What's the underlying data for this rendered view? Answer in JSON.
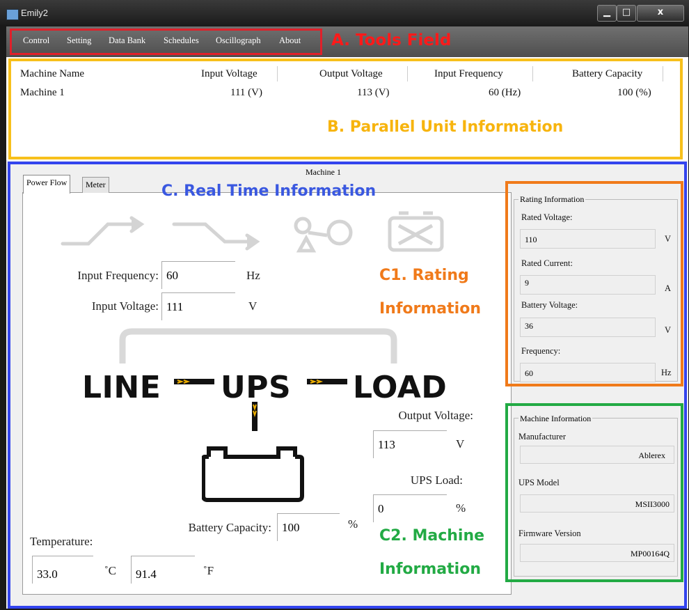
{
  "window": {
    "title": "Emily2",
    "min_glyph": "▁",
    "max_glyph": "□",
    "close_glyph": "x"
  },
  "menu": [
    "Control",
    "Setting",
    "Data Bank",
    "Schedules",
    "Oscillograph",
    "About"
  ],
  "annotations": {
    "tools": "A. Tools  Field",
    "parallel": "B. Parallel Unit Information",
    "realtime": "C. Real Time Information",
    "rating_1": "C1. Rating",
    "rating_2": "Information",
    "machine_1": "C2. Machine",
    "machine_2": "Information"
  },
  "colors": {
    "tools": "#e0202a",
    "parallel": "#f7c01c",
    "realtime": "#3344ee",
    "rating": "#f07a1a",
    "machine": "#22aa44"
  },
  "table": {
    "headers": [
      "Machine Name",
      "Input Voltage",
      "Output Voltage",
      "Input Frequency",
      "Battery Capacity"
    ],
    "rows": [
      [
        "Machine 1",
        "111 (V)",
        "113 (V)",
        "60 (Hz)",
        "100 (%)"
      ]
    ]
  },
  "realtime": {
    "machine_label": "Machine 1",
    "tabs": [
      "Power Flow",
      "Meter"
    ],
    "input_frequency": {
      "label": "Input Frequency:",
      "value": "60",
      "unit": "Hz"
    },
    "input_voltage": {
      "label": "Input Voltage:",
      "value": "111",
      "unit": "V"
    },
    "flow_words": {
      "line": "LINE",
      "ups": "UPS",
      "load": "LOAD"
    },
    "output_voltage": {
      "label": "Output Voltage:",
      "value": "113",
      "unit": "V"
    },
    "ups_load": {
      "label": "UPS Load:",
      "value": "0",
      "unit": "%"
    },
    "battery_capacity": {
      "label": "Battery Capacity:",
      "value": "100",
      "unit": "%"
    },
    "temperature": {
      "label": "Temperature:",
      "celsius": "33.0",
      "c_unit": "˚C",
      "fahrenheit": "91.4",
      "f_unit": "˚F"
    }
  },
  "rating": {
    "title": "Rating Information",
    "rated_voltage": {
      "label": "Rated Voltage:",
      "value": "110",
      "unit": "V"
    },
    "rated_current": {
      "label": "Rated Current:",
      "value": "9",
      "unit": "A"
    },
    "battery_voltage": {
      "label": "Battery Voltage:",
      "value": "36",
      "unit": "V"
    },
    "frequency": {
      "label": "Frequency:",
      "value": "60",
      "unit": "Hz"
    }
  },
  "machine_info": {
    "title": "Machine Information",
    "manufacturer": {
      "label": "Manufacturer",
      "value": "Ablerex"
    },
    "ups_model": {
      "label": "UPS Model",
      "value": "MSII3000"
    },
    "firmware": {
      "label": "Firmware Version",
      "value": "MP00164Q"
    }
  }
}
